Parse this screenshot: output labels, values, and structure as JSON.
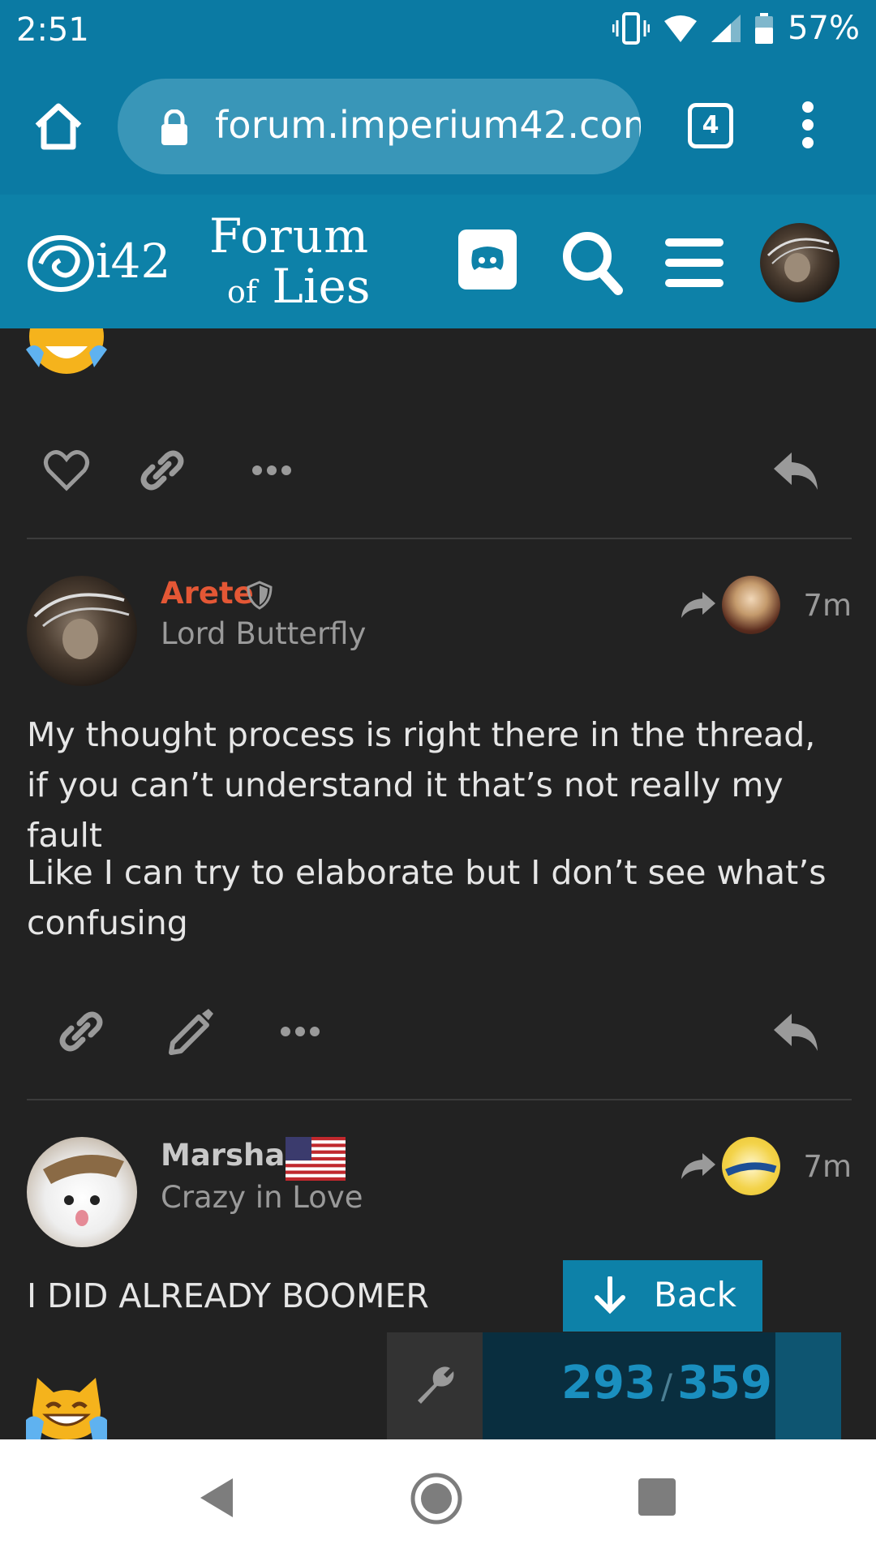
{
  "status_bar": {
    "time": "2:51",
    "battery": "57%"
  },
  "browser": {
    "url": "forum.imperium42.com",
    "tab_count": "4"
  },
  "forum_header": {
    "logo_short": "i42",
    "logo_line1": "Forum",
    "logo_line2_small": "of",
    "logo_line2": "Lies"
  },
  "posts": [
    {
      "username": "Arete",
      "user_title": "Lord Butterfly",
      "time": "7m",
      "paragraphs": [
        "My thought process is right there in the thread, if you can’t understand it that’s not really my fault",
        "Like I can try to elaborate but I don’t see what’s confusing"
      ]
    },
    {
      "username": "Marshal",
      "user_title": "Crazy in Love",
      "time": "7m",
      "paragraphs": [
        "I DID ALREADY BOOMER"
      ]
    }
  ],
  "back_button": {
    "label": "Back"
  },
  "timeline": {
    "current": "293",
    "separator": "/",
    "total": "359",
    "progress": 0.816
  },
  "colors": {
    "brand": "#0d81a8",
    "username_staff": "#e45735",
    "username": "#c8c8c8",
    "background": "#222222"
  }
}
